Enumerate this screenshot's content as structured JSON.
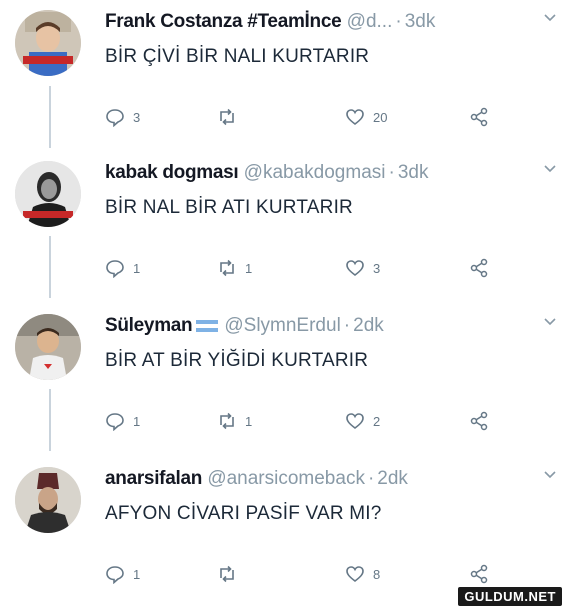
{
  "tweets": [
    {
      "name": "Frank Costanza #Teamİnce",
      "handle": "@d...",
      "time": "3dk",
      "text": "BİR ÇİVİ BİR NALI KURTARIR",
      "reply_count": "3",
      "retweet_count": "",
      "like_count": "20",
      "avatar_icon": "boy-photo-avatar"
    },
    {
      "name": "kabak dogması",
      "handle": "@kabakdogmasi",
      "time": "3dk",
      "text": "BİR NAL BİR ATI KURTARIR",
      "reply_count": "1",
      "retweet_count": "1",
      "like_count": "3",
      "avatar_icon": "man-portrait-avatar"
    },
    {
      "name": "Süleyman",
      "handle": "@SlymnErdul",
      "time": "2dk",
      "text": "BİR AT BİR YİĞİDİ KURTARIR",
      "reply_count": "1",
      "retweet_count": "1",
      "like_count": "2",
      "avatar_icon": "child-photo-avatar",
      "flag": "flag-icon"
    },
    {
      "name": "anarsifalan",
      "handle": "@anarsicomeback",
      "time": "2dk",
      "text": "AFYON CİVARI PASİF VAR MI?",
      "reply_count": "1",
      "retweet_count": "",
      "like_count": "8",
      "avatar_icon": "ottoman-portrait-avatar"
    }
  ],
  "separator": "·",
  "watermark": "GULDUM.NET",
  "colors": {
    "text": "#141823",
    "secondary": "#8899a6",
    "icon": "#657786",
    "thread_line": "#c9d3dc"
  }
}
